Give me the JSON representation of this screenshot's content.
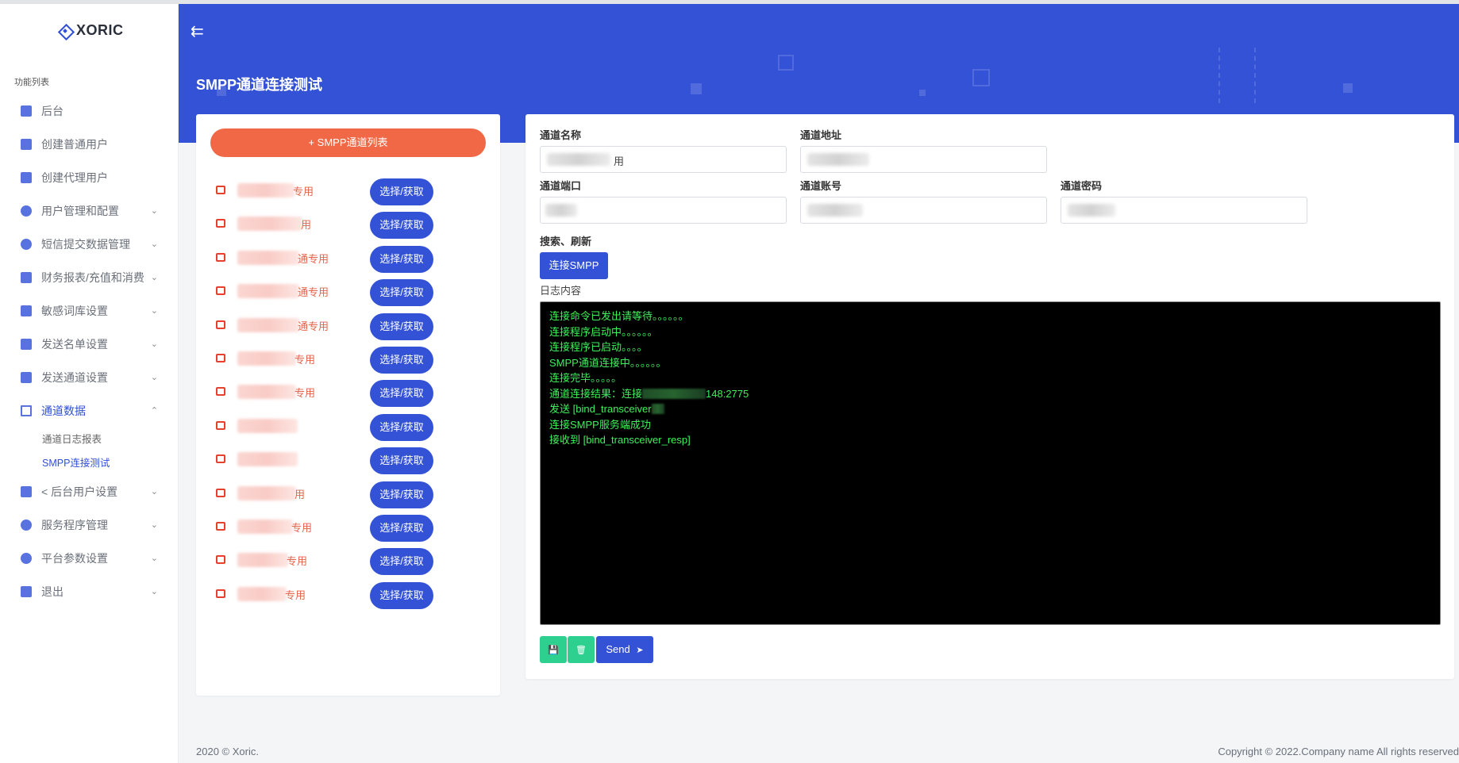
{
  "brand": {
    "name": "XORIC"
  },
  "sidebar": {
    "section_title": "功能列表",
    "items": [
      {
        "label": "后台",
        "chevron": false
      },
      {
        "label": "创建普通用户",
        "chevron": false
      },
      {
        "label": "创建代理用户",
        "chevron": false
      },
      {
        "label": "用户管理和配置",
        "chevron": true
      },
      {
        "label": "短信提交数据管理",
        "chevron": true
      },
      {
        "label": "财务报表/充值和消费",
        "chevron": true
      },
      {
        "label": "敏感词库设置",
        "chevron": true
      },
      {
        "label": "发送名单设置",
        "chevron": true
      },
      {
        "label": "发送通道设置",
        "chevron": true
      },
      {
        "label": "通道数据",
        "chevron": true,
        "expanded": true
      },
      {
        "label": "< 后台用户设置",
        "chevron": true
      },
      {
        "label": "服务程序管理",
        "chevron": true
      },
      {
        "label": "平台参数设置",
        "chevron": true
      },
      {
        "label": "退出",
        "chevron": true
      }
    ],
    "subitems": [
      "通道日志报表",
      "SMPP连接测试"
    ],
    "chevron_down": "⌄",
    "chevron_up": "⌃"
  },
  "header": {
    "collapse_icon": "⇇",
    "page_title": "SMPP通道连接测试"
  },
  "left_panel": {
    "list_button": "+ SMPP通道列表",
    "rows": [
      {
        "suffix": "专用",
        "pick_label": "选择/获取"
      },
      {
        "suffix": "用",
        "pick_label": "选择/获取"
      },
      {
        "suffix": "通专用",
        "pick_label": "选择/获取"
      },
      {
        "suffix": "通专用",
        "pick_label": "选择/获取"
      },
      {
        "suffix": "通专用",
        "pick_label": "选择/获取"
      },
      {
        "suffix": "专用",
        "pick_label": "选择/获取"
      },
      {
        "suffix": "专用",
        "pick_label": "选择/获取"
      },
      {
        "suffix": "",
        "pick_label": "选择/获取"
      },
      {
        "suffix": "",
        "pick_label": "选择/获取"
      },
      {
        "suffix": "用",
        "pick_label": "选择/获取"
      },
      {
        "suffix": "专用",
        "pick_label": "选择/获取"
      },
      {
        "suffix": "专用",
        "pick_label": "选择/获取"
      },
      {
        "suffix": "专用",
        "pick_label": "选择/获取"
      }
    ]
  },
  "form": {
    "channel_name_label": "通道名称",
    "channel_name_suffix": "用",
    "channel_address_label": "通道地址",
    "channel_port_label": "通道端口",
    "channel_account_label": "通道账号",
    "channel_password_label": "通道密码",
    "search_refresh_label": "搜索、刷新",
    "connect_button": "连接SMPP",
    "log_label": "日志内容"
  },
  "console": {
    "lines": [
      "连接命令已发出请等待。。。。。。",
      "连接程序启动中。。。。。。",
      "连接程序已启动。。。。",
      "SMPP通道连接中。。。。。。",
      "连接完毕。。。。。"
    ],
    "result_prefix": "通道连接结果：连接",
    "result_suffix": "148:2775",
    "send_prefix": "发送 [bind_transceiver",
    "line_success": "连接SMPP服务端成功",
    "line_received": "接收到 [bind_transceiver_resp]"
  },
  "actions": {
    "save_icon": "💾",
    "delete_icon": "🗑",
    "send_label": "Send",
    "send_icon": "➤"
  },
  "footer": {
    "left": "2020 © Xoric.",
    "right": "Copyright © 2022.Company name All rights reserved"
  },
  "colors": {
    "primary": "#3352d6",
    "accent": "#f06846",
    "success": "#2ed08f",
    "console_text": "#3df25b"
  }
}
